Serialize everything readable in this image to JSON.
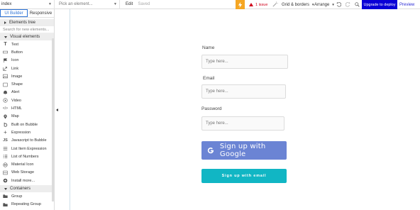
{
  "topbar": {
    "page": "index",
    "element_picker": "Pick an element...",
    "edit": "Edit",
    "saved": "Saved",
    "issues": "1 issue",
    "grid_borders": "Grid & borders",
    "arrange": "Arrange",
    "upgrade": "Upgrade to deploy",
    "preview": "Preview",
    "colors": {
      "bolt": "#f5a623",
      "issue": "#d0021b",
      "upgrade": "#0a00d6"
    }
  },
  "sidebar": {
    "tabs": [
      {
        "label": "UI Builder",
        "active": true
      },
      {
        "label": "Responsive",
        "active": false
      }
    ],
    "elements_tree": "Elements tree",
    "search_placeholder": "Search for new elements...",
    "visual_elements": "Visual elements",
    "items": [
      {
        "label": "Text",
        "icon": "text-icon"
      },
      {
        "label": "Button",
        "icon": "button-icon"
      },
      {
        "label": "Icon",
        "icon": "flag-icon"
      },
      {
        "label": "Link",
        "icon": "link-icon"
      },
      {
        "label": "Image",
        "icon": "image-icon"
      },
      {
        "label": "Shape",
        "icon": "shape-icon"
      },
      {
        "label": "Alert",
        "icon": "bell-icon"
      },
      {
        "label": "Video",
        "icon": "video-icon"
      },
      {
        "label": "HTML",
        "icon": "code-icon"
      },
      {
        "label": "Map",
        "icon": "map-pin-icon"
      },
      {
        "label": "Built on Bubble",
        "icon": "bubble-icon"
      },
      {
        "label": "Expression",
        "icon": "plus-icon"
      },
      {
        "label": "Javascript to Bubble",
        "icon": "js-icon"
      },
      {
        "label": "List Item Expression",
        "icon": "list-icon"
      },
      {
        "label": "List of Numbers",
        "icon": "numbers-icon"
      },
      {
        "label": "Material Icon",
        "icon": "material-icon"
      },
      {
        "label": "Web Storage",
        "icon": "storage-icon"
      },
      {
        "label": "Install more...",
        "icon": "plus-circle-icon"
      }
    ],
    "containers": "Containers",
    "container_items": [
      {
        "label": "Group",
        "icon": "group-icon"
      },
      {
        "label": "Repeating Group",
        "icon": "repeating-group-icon"
      }
    ]
  },
  "form": {
    "name_label": "Name",
    "name_placeholder": "Type here...",
    "email_label": "Email",
    "email_placeholder": "Type here...",
    "password_label": "Password",
    "password_placeholder": "Type here...",
    "google_button": "Sign up with Google",
    "email_button": "Sign up with email",
    "colors": {
      "google": "#6b84d4",
      "email": "#11b6c4"
    }
  }
}
